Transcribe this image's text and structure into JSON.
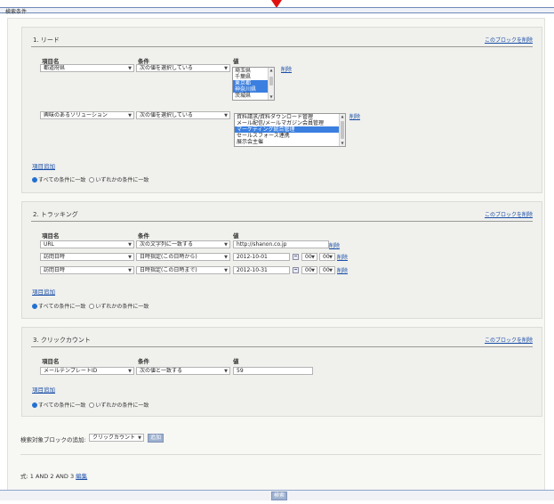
{
  "header": {
    "title": "検索条件"
  },
  "blocks": [
    {
      "title": "1. リード",
      "delete_label": "このブロックを削除",
      "col_item": "項目名",
      "col_cond": "条件",
      "col_value": "値",
      "rows": [
        {
          "item": "都道府県",
          "cond": "次の値を選択している",
          "options": [
            "埼玉県",
            "千葉県",
            "東京都",
            "神奈川県",
            "茨城県"
          ],
          "selected": [
            "東京都",
            "神奈川県"
          ],
          "delete": "削除"
        },
        {
          "item": "興味のあるソリューション",
          "cond": "次の値を選択している",
          "options": [
            "資料請求/資料ダウンロード管理",
            "メール配信/メールマガジン会員管理",
            "マーケティング統合管理",
            "セールスフォース連携",
            "展示会主催"
          ],
          "selected": [
            "マーケティング統合管理"
          ],
          "delete": "削除"
        }
      ],
      "add_label": "項目追加",
      "radio_all": "すべての条件に一致",
      "radio_any": "いずれかの条件に一致"
    },
    {
      "title": "2. トラッキング",
      "delete_label": "このブロックを削除",
      "col_item": "項目名",
      "col_cond": "条件",
      "col_value": "値",
      "rows": [
        {
          "item": "URL",
          "cond": "次の文字列に一致する",
          "value": "http://shanon.co.jp",
          "delete": "削除"
        },
        {
          "item": "訪問日時",
          "cond": "日時指定(この日時から)",
          "value": "2012-10-01",
          "hour": "00",
          "minute": "00",
          "delete": "削除"
        },
        {
          "item": "訪問日時",
          "cond": "日時指定(この日時まで)",
          "value": "2012-10-31",
          "hour": "00",
          "minute": "00",
          "delete": "削除"
        }
      ],
      "add_label": "項目追加",
      "radio_all": "すべての条件に一致",
      "radio_any": "いずれかの条件に一致"
    },
    {
      "title": "3. クリックカウント",
      "delete_label": "このブロックを削除",
      "col_item": "項目名",
      "col_cond": "条件",
      "col_value": "値",
      "rows": [
        {
          "item": "メールテンプレートID",
          "cond": "次の値と一致する",
          "value": "59"
        }
      ],
      "add_label": "項目追加",
      "radio_all": "すべての条件に一致",
      "radio_any": "いずれかの条件に一致"
    }
  ],
  "footer": {
    "add_block_label": "検索対象ブロックの追加:",
    "add_block_select": "クリックカウント",
    "add_block_button": "追加",
    "formula_label": "式:",
    "formula": "1 AND 2 AND 3",
    "formula_edit": "編集",
    "search_button": "検索"
  },
  "colors": {
    "accent": "#3a7fe0",
    "link": "#1a4fa8",
    "marker": "#e01010",
    "button": "#9db0cf"
  }
}
